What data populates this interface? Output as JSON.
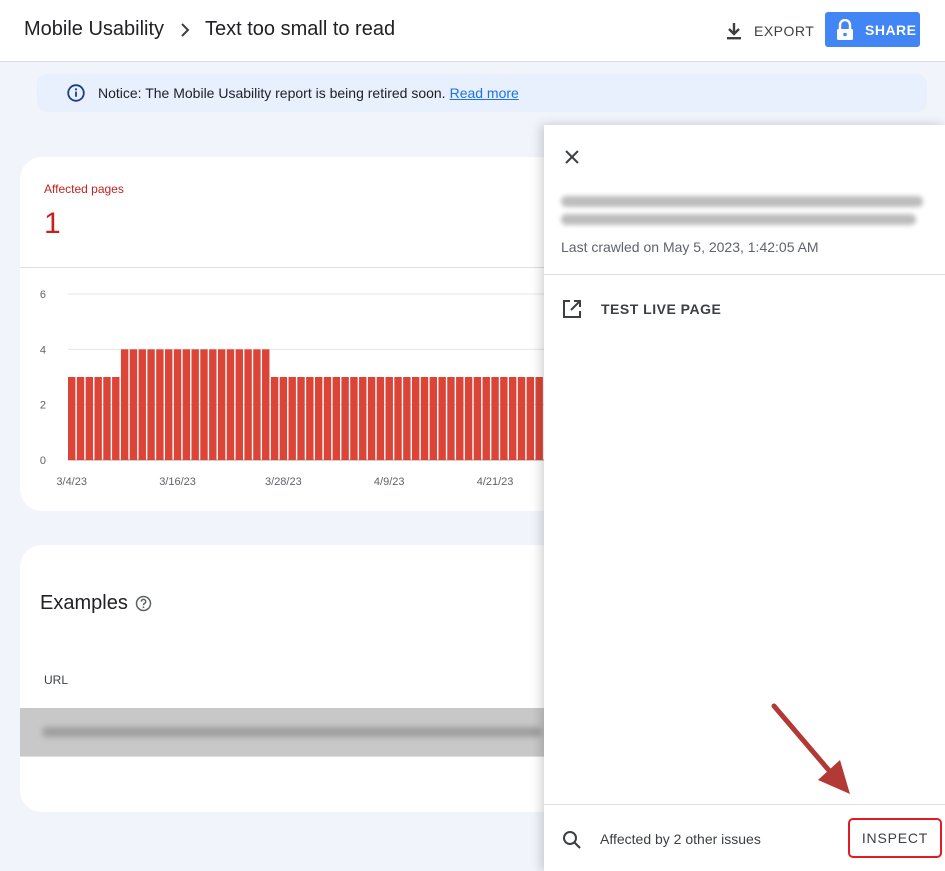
{
  "header": {
    "breadcrumb_root": "Mobile Usability",
    "title": "Text too small to read",
    "export_label": "EXPORT",
    "share_label": "SHARE"
  },
  "notice": {
    "text": "Notice: The Mobile Usability report is being retired soon.",
    "link_text": "Read more"
  },
  "summary": {
    "label": "Affected pages",
    "value": "1"
  },
  "chart_data": {
    "type": "bar",
    "x_tick_labels": [
      "3/4/23",
      "3/16/23",
      "3/28/23",
      "4/9/23",
      "4/21/23"
    ],
    "y_ticks": [
      0,
      2,
      4,
      6
    ],
    "ylim": [
      0,
      6
    ],
    "values": [
      3,
      3,
      3,
      3,
      3,
      3,
      4,
      4,
      4,
      4,
      4,
      4,
      4,
      4,
      4,
      4,
      4,
      4,
      4,
      4,
      4,
      4,
      4,
      3,
      3,
      3,
      3,
      3,
      3,
      3,
      3,
      3,
      3,
      3,
      3,
      3,
      3,
      3,
      3,
      3,
      3,
      3,
      3,
      3,
      3,
      3,
      3,
      3,
      3,
      3,
      3,
      3,
      3,
      3,
      3
    ],
    "bar_color": "#db4437",
    "grid": true
  },
  "examples": {
    "title": "Examples",
    "url_column": "URL"
  },
  "panel": {
    "last_crawled": "Last crawled on May 5, 2023, 1:42:05 AM",
    "test_live_label": "TEST LIVE PAGE",
    "affected_other": "Affected by 2 other issues",
    "inspect_label": "INSPECT"
  },
  "colors": {
    "accent": "#4285f4",
    "error": "#c5221f",
    "highlight": "#e31b23",
    "link": "#1a73e8"
  }
}
